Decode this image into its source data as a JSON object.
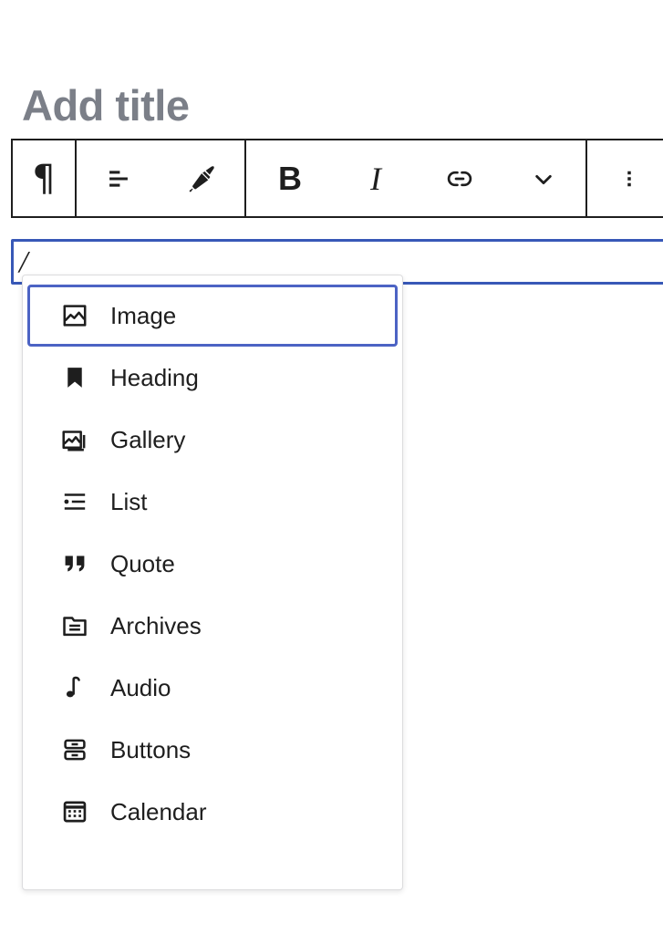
{
  "colors": {
    "accent_blue": "#3858b7",
    "selection_blue": "#4c63c4",
    "title_gray": "#7b7f88",
    "ink": "#1e1e1e",
    "popover_border": "#dcdcde",
    "gutter": "#f6f8fb"
  },
  "editor": {
    "title_placeholder": "Add title",
    "paragraph_value": "/"
  },
  "toolbar": {
    "groups": [
      {
        "buttons": [
          {
            "label": "¶",
            "name": "paragraph-block-type-button",
            "icon": "pilcrow-icon"
          }
        ]
      },
      {
        "buttons": [
          {
            "label": "",
            "name": "align-text-button",
            "icon": "align-left-icon"
          },
          {
            "label": "",
            "name": "highlight-button",
            "icon": "paintbrush-icon"
          }
        ]
      },
      {
        "buttons": [
          {
            "label": "B",
            "name": "bold-button",
            "icon": "bold-icon"
          },
          {
            "label": "I",
            "name": "italic-button",
            "icon": "italic-icon"
          },
          {
            "label": "",
            "name": "link-button",
            "icon": "link-icon"
          },
          {
            "label": "",
            "name": "more-rich-text-button",
            "icon": "chevron-down-icon"
          }
        ]
      },
      {
        "buttons": [
          {
            "label": "",
            "name": "block-options-button",
            "icon": "three-dots-vertical-icon"
          }
        ]
      }
    ]
  },
  "inserter": {
    "items": [
      {
        "label": "Image",
        "icon": "image-icon",
        "selected": true
      },
      {
        "label": "Heading",
        "icon": "bookmark-icon",
        "selected": false
      },
      {
        "label": "Gallery",
        "icon": "gallery-icon",
        "selected": false
      },
      {
        "label": "List",
        "icon": "list-icon",
        "selected": false
      },
      {
        "label": "Quote",
        "icon": "quote-icon",
        "selected": false
      },
      {
        "label": "Archives",
        "icon": "archive-icon",
        "selected": false
      },
      {
        "label": "Audio",
        "icon": "audio-icon",
        "selected": false
      },
      {
        "label": "Buttons",
        "icon": "buttons-icon",
        "selected": false
      },
      {
        "label": "Calendar",
        "icon": "calendar-icon",
        "selected": false
      }
    ]
  }
}
